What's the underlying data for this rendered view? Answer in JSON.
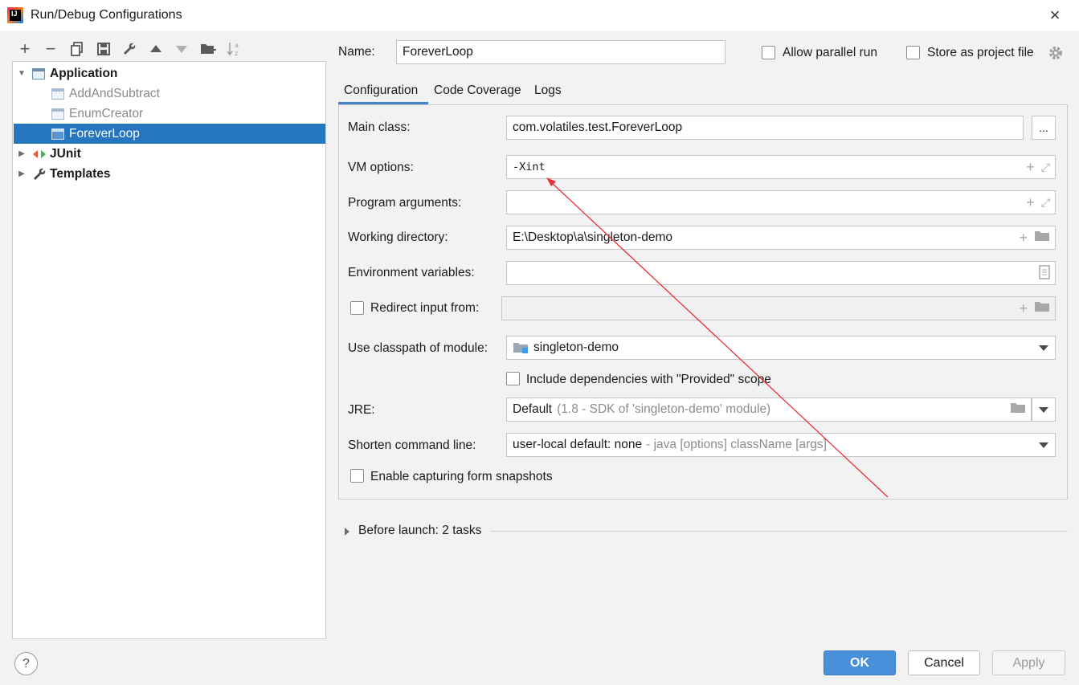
{
  "window": {
    "title": "Run/Debug Configurations",
    "close_glyph": "×"
  },
  "toolbar": {
    "add": "+",
    "remove": "−",
    "copy": "⧉",
    "save": "💾",
    "edit_templates": "🔧",
    "move_up": "▲",
    "move_down": "▼",
    "new_folder": "📁",
    "sort": "↓ᵃᶻ"
  },
  "tree": {
    "application": "Application",
    "items": [
      "AddAndSubtract",
      "EnumCreator",
      "ForeverLoop"
    ],
    "junit": "JUnit",
    "templates": "Templates"
  },
  "header": {
    "name_label": "Name:",
    "name_value": "ForeverLoop",
    "allow_parallel": "Allow parallel run",
    "store_project": "Store as project file"
  },
  "tabs": [
    "Configuration",
    "Code Coverage",
    "Logs"
  ],
  "form": {
    "main_class_label": "Main class:",
    "main_class_value": "com.volatiles.test.ForeverLoop",
    "browse": "...",
    "vm_label": "VM options:",
    "vm_value": "-Xint",
    "prog_args_label": "Program arguments:",
    "workdir_label": "Working directory:",
    "workdir_value": "E:\\Desktop\\a\\singleton-demo",
    "env_label": "Environment variables:",
    "redirect_label": "Redirect input from:",
    "classpath_label": "Use classpath of module:",
    "classpath_value": "singleton-demo",
    "include_deps": "Include dependencies with \"Provided\" scope",
    "jre_label": "JRE:",
    "jre_value": "Default",
    "jre_hint": "(1.8 - SDK of 'singleton-demo' module)",
    "shorten_label": "Shorten command line:",
    "shorten_value": "user-local default: none",
    "shorten_hint": "- java [options] className [args]",
    "snapshots": "Enable capturing form snapshots"
  },
  "before_launch": "Before launch: 2 tasks",
  "buttons": {
    "ok": "OK",
    "cancel": "Cancel",
    "apply": "Apply",
    "help": "?"
  },
  "colors": {
    "selection": "#2675bf",
    "ok": "#4a8fd9",
    "annotation_arrow": "#e8303a"
  }
}
